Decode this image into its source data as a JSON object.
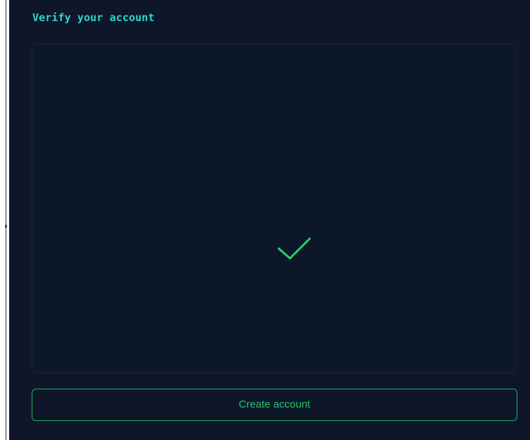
{
  "header": {
    "title": "Verify your account"
  },
  "verification": {
    "status_icon": "checkmark-icon",
    "check_color": "#2ecf72"
  },
  "actions": {
    "create_account_label": "Create account"
  },
  "colors": {
    "background": "#0d1729",
    "title_accent": "#2fd3d0",
    "button_accent": "#22b35d"
  }
}
